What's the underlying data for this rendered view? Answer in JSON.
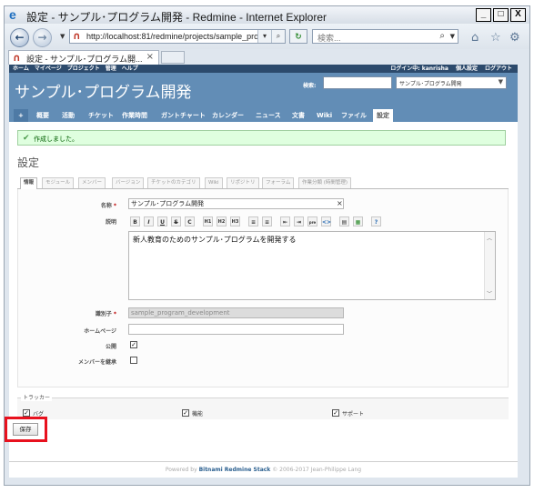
{
  "browser": {
    "window_title": "設定 - サンプル･プログラム開発 - Redmine - Internet Explorer",
    "controls": {
      "minimize": "_",
      "maximize": "□",
      "close": "X"
    },
    "url": "http://localhost:81/redmine/projects/sample_pro",
    "search_placeholder": "検索...",
    "tab_title": "設定 - サンプル･プログラム開...",
    "tab_close": "×"
  },
  "redmine": {
    "top_menu": [
      "ホーム",
      "マイページ",
      "プロジェクト",
      "管理",
      "ヘルプ"
    ],
    "logged_in": "ログイン中: kanrisha",
    "account": "個人設定",
    "logout": "ログアウト",
    "project_title": "サンプル･プログラム開発",
    "search_label": "検索:",
    "project_jump": "サンプル･プログラム開発",
    "main_menu": {
      "plus": "+",
      "items": [
        "概要",
        "活動",
        "チケット",
        "作業時間",
        "ガントチャート",
        "カレンダー",
        "ニュース",
        "文書",
        "Wiki",
        "ファイル",
        "設定"
      ]
    },
    "flash_notice": "作成しました。",
    "page_heading": "設定",
    "settings_tabs": [
      "情報",
      "モジュール",
      "メンバー",
      "バージョン",
      "チケットのカテゴリ",
      "Wiki",
      "リポジトリ",
      "フォーラム",
      "作業分類 (時間管理)"
    ],
    "form": {
      "name_label": "名称",
      "name_value": "サンプル･プログラム開発",
      "description_label": "説明",
      "toolbar": [
        "B",
        "I",
        "U",
        "S",
        "C",
        "H1",
        "H2",
        "H3",
        "≡",
        "≡",
        "⇤",
        "⇥",
        "pre",
        "<>",
        "▤",
        "▦",
        "?"
      ],
      "description_value": "新人教育のためのサンプル･プログラムを開発する",
      "identifier_label": "識別子",
      "identifier_value": "sample_program_development",
      "homepage_label": "ホームページ",
      "homepage_value": "",
      "public_label": "公開",
      "public_checked": true,
      "inherit_label": "メンバーを継承",
      "inherit_checked": false,
      "required_mark": "*"
    },
    "trackers": {
      "legend": "トラッカー",
      "items": [
        {
          "label": "バグ",
          "checked": true
        },
        {
          "label": "機能",
          "checked": true
        },
        {
          "label": "サポート",
          "checked": true
        }
      ]
    },
    "save_button": "保存",
    "footer": {
      "prefix": "Powered by",
      "link": "Bitnami Redmine Stack",
      "suffix": "© 2006-2017 Jean-Philippe Lang"
    }
  },
  "colors": {
    "header_bg": "#628db6",
    "top_menu_bg": "#2c4a6c",
    "flash_bg": "#dfffdf",
    "highlight": "#e8111e"
  }
}
